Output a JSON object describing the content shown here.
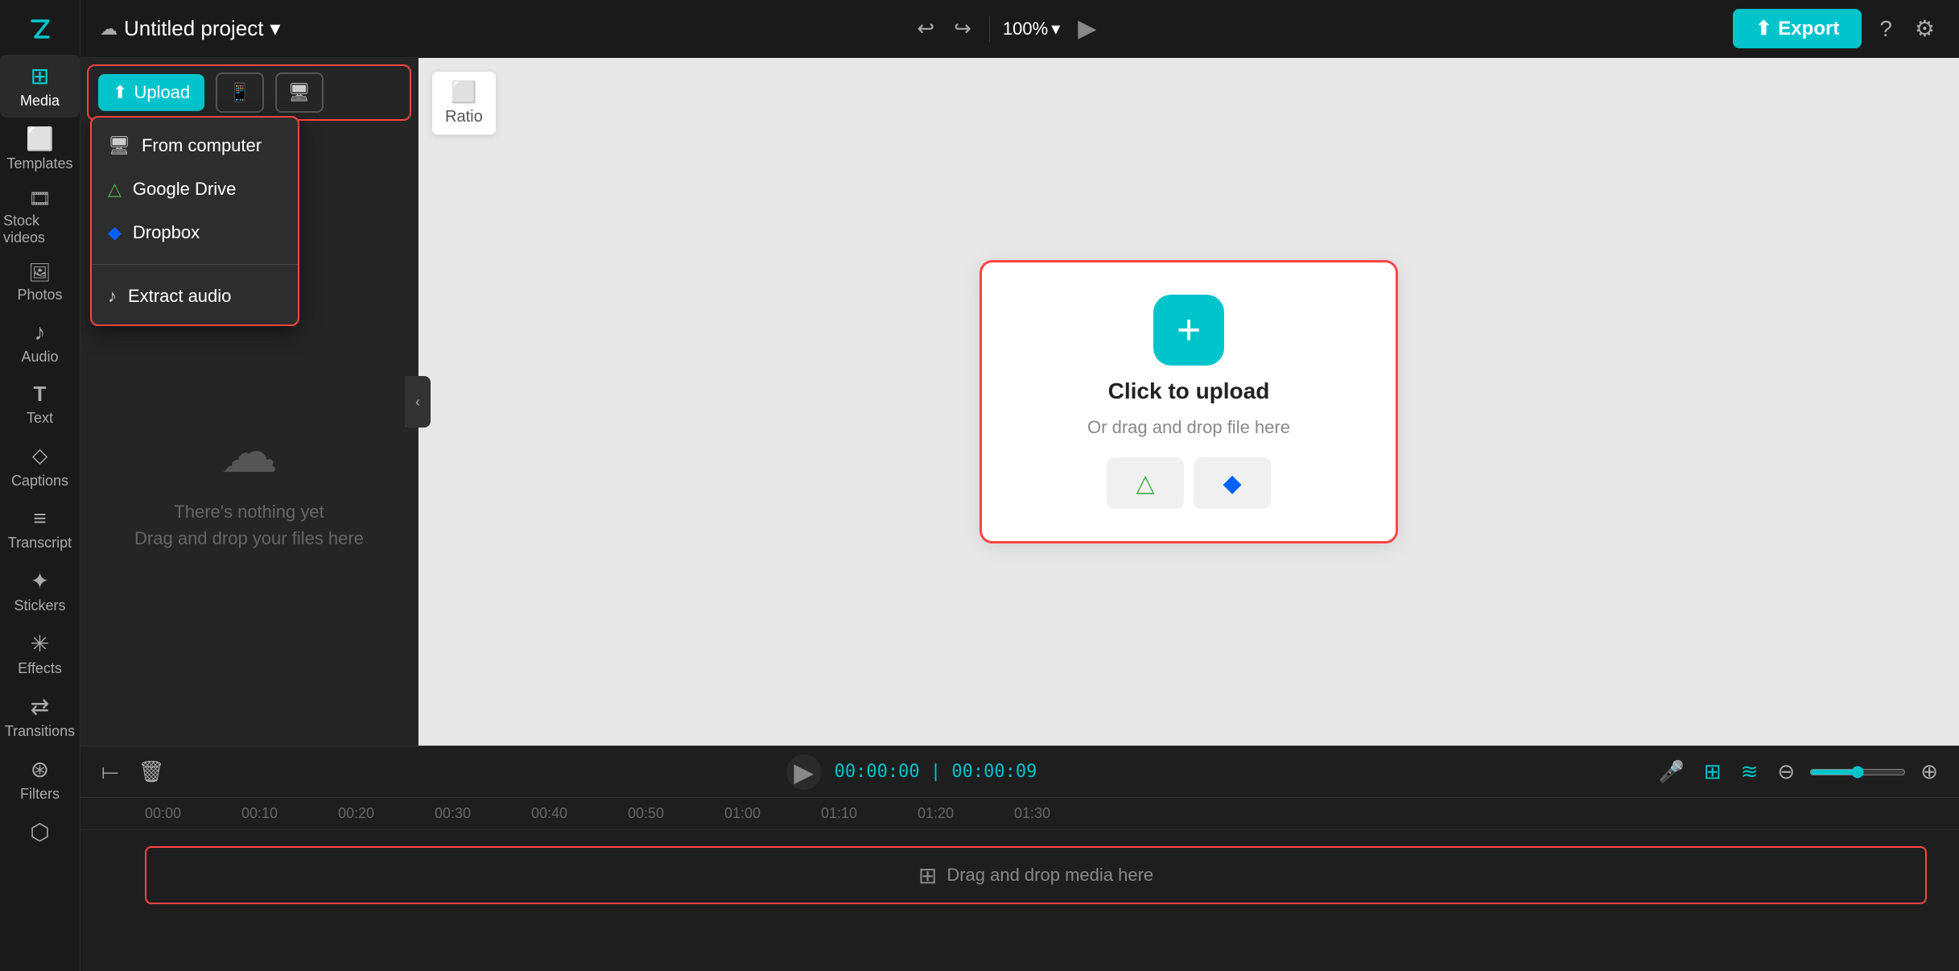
{
  "app": {
    "logo_label": "Z"
  },
  "sidebar": {
    "items": [
      {
        "id": "media",
        "label": "Media",
        "icon": "⊞",
        "active": true
      },
      {
        "id": "templates",
        "label": "Templates",
        "icon": "⬜"
      },
      {
        "id": "stock-videos",
        "label": "Stock videos",
        "icon": "🎬"
      },
      {
        "id": "photos",
        "label": "Photos",
        "icon": "🖼"
      },
      {
        "id": "audio",
        "label": "Audio",
        "icon": "♪"
      },
      {
        "id": "text",
        "label": "Text",
        "icon": "T"
      },
      {
        "id": "captions",
        "label": "Captions",
        "icon": "⬦"
      },
      {
        "id": "transcript",
        "label": "Transcript",
        "icon": "≡"
      },
      {
        "id": "stickers",
        "label": "Stickers",
        "icon": "✦"
      },
      {
        "id": "effects",
        "label": "Effects",
        "icon": "✳"
      },
      {
        "id": "transitions",
        "label": "Transitions",
        "icon": "⇄"
      },
      {
        "id": "filters",
        "label": "Filters",
        "icon": "⊛"
      },
      {
        "id": "subtitles",
        "label": "",
        "icon": "⬡"
      }
    ]
  },
  "topbar": {
    "project_title": "Untitled project",
    "dropdown_icon": "▾",
    "zoom_value": "100%",
    "undo_label": "↩",
    "redo_label": "↪",
    "export_label": "Export",
    "help_icon": "?",
    "settings_icon": "⚙"
  },
  "panel": {
    "tabs": [
      {
        "id": "upload",
        "label": "Upload",
        "icon": "⬆"
      },
      {
        "id": "mobile",
        "icon": "📱"
      },
      {
        "id": "screen",
        "icon": "🖥"
      }
    ],
    "upload_dropdown": {
      "items": [
        {
          "id": "from-computer",
          "label": "From computer",
          "icon": "🖥"
        },
        {
          "id": "google-drive",
          "label": "Google Drive",
          "icon": "△"
        },
        {
          "id": "dropbox",
          "label": "Dropbox",
          "icon": "◆"
        }
      ],
      "secondary_items": [
        {
          "id": "extract-audio",
          "label": "Extract audio",
          "icon": "♪"
        }
      ]
    },
    "empty_state": {
      "icon": "☁",
      "line1": "There's nothing yet",
      "line2": "Drag and drop your files here"
    }
  },
  "ratio_btn": {
    "icon": "⬜",
    "label": "Ratio"
  },
  "upload_card": {
    "plus_icon": "+",
    "title": "Click to upload",
    "subtitle": "Or drag and drop file here",
    "google_drive_icon": "△",
    "dropbox_icon": "◆"
  },
  "timeline": {
    "play_icon": "▶",
    "current_time": "00:00:00",
    "total_time": "00:00:09",
    "mic_icon": "🎤",
    "marks": [
      "00:00",
      "00:10",
      "00:20",
      "00:30",
      "00:40",
      "00:50",
      "01:00",
      "01:10",
      "01:20",
      "01:30"
    ],
    "drop_zone": {
      "icon": "⊞",
      "label": "Drag and drop media here"
    }
  }
}
